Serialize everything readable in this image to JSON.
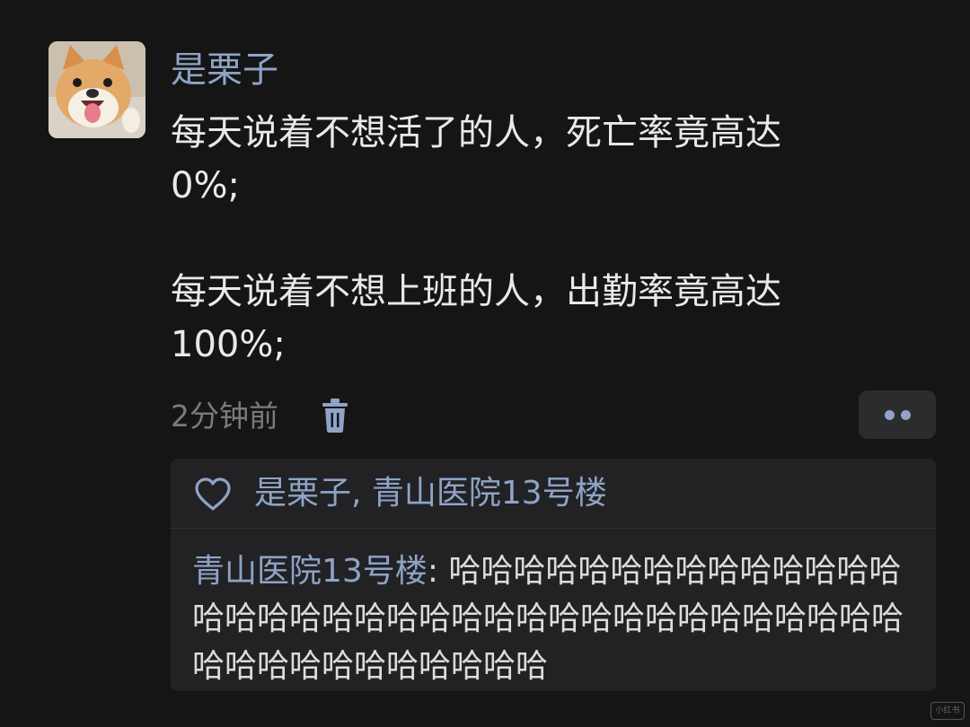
{
  "post": {
    "username": "是栗子",
    "line1a": "每天说着不想活了的人，死亡率竟高达",
    "line1b": "0%;",
    "line2a": "每天说着不想上班的人，出勤率竟高达",
    "line2b": "100%;",
    "time": "2分钟前",
    "avatar_icon": "shiba-dog-avatar",
    "delete_icon": "trash-icon",
    "more_icon": "two-dots-icon"
  },
  "interactions": {
    "heart_icon": "heart-outline-icon",
    "likes_text": "是栗子, 青山医院13号楼",
    "comment": {
      "author": "青山医院13号楼",
      "separator": ": ",
      "text": "哈哈哈哈哈哈哈哈哈哈哈哈哈哈哈哈哈哈哈哈哈哈哈哈哈哈哈哈哈哈哈哈哈哈哈哈哈哈哈哈哈哈哈哈哈哈哈"
    }
  },
  "colors": {
    "background": "#151515",
    "accent": "#8fa3c7",
    "text": "#e9e9e9",
    "muted": "#7b7b7b",
    "panel": "#222224"
  }
}
